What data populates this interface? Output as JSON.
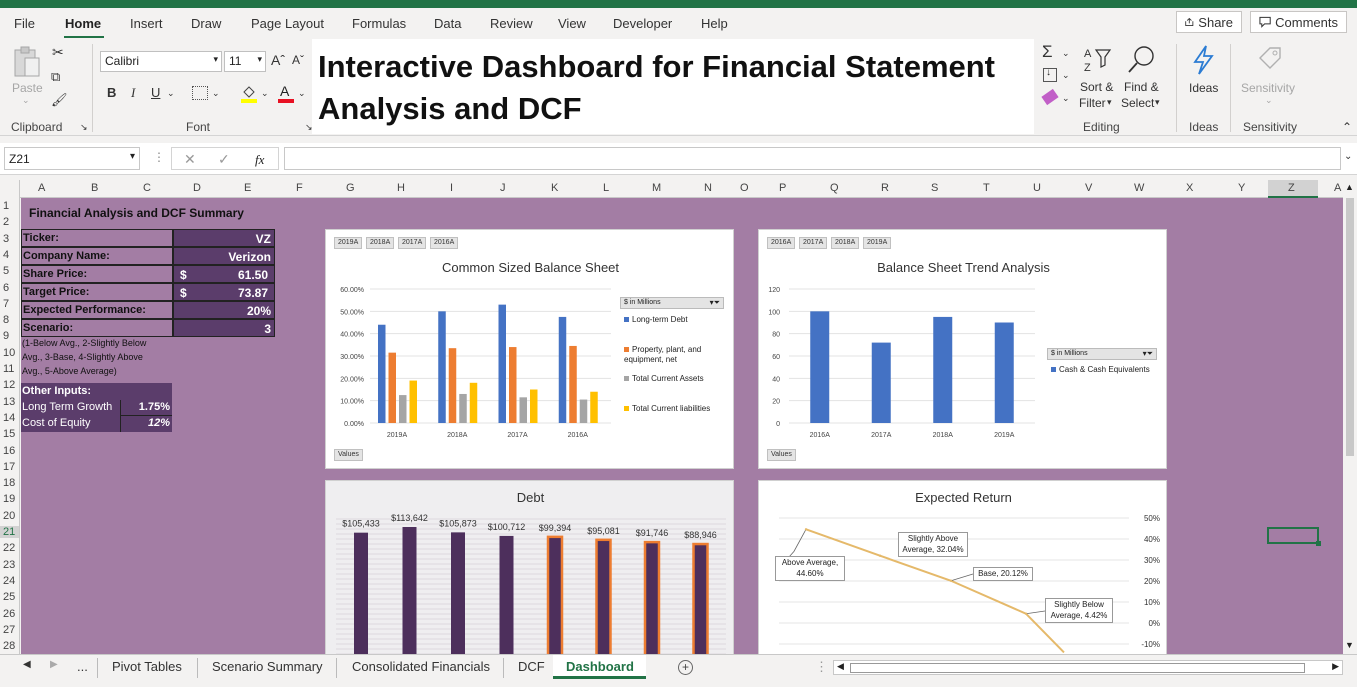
{
  "menu": {
    "tabs": [
      "File",
      "Home",
      "Insert",
      "Draw",
      "Page Layout",
      "Formulas",
      "Data",
      "Review",
      "View",
      "Developer",
      "Help"
    ],
    "active": "Home",
    "share_label": "Share",
    "comments_label": "Comments"
  },
  "ribbon": {
    "paste_label": "Paste",
    "clipboard_label": "Clipboard",
    "font_label": "Font",
    "font_name": "Calibri",
    "font_size": "11",
    "bold": "B",
    "italic": "I",
    "underline": "U",
    "grow_font": "Aˆ",
    "shrink_font": "Aˇ",
    "font_color_letter": "A",
    "editing_label": "Editing",
    "sort_filter_label_1": "Sort &",
    "sort_filter_label_2": "Filter",
    "find_select_label_1": "Find &",
    "find_select_label_2": "Select",
    "ideas_label": "Ideas",
    "ideas_group_label": "Ideas",
    "sensitivity_label": "Sensitivity",
    "sensitivity_group_label": "Sensitivity",
    "colors": {
      "green": "#217346",
      "font_red": "#e81123",
      "fill_yellow": "#ffff00",
      "blue": "#2b7cd3"
    }
  },
  "dashboard_title": {
    "line1": "Interactive Dashboard for Financial Statement",
    "line2": "Analysis and DCF"
  },
  "formula_bar": {
    "name_box": "Z21",
    "formula": ""
  },
  "columns": [
    "A",
    "B",
    "C",
    "D",
    "E",
    "F",
    "G",
    "H",
    "I",
    "J",
    "K",
    "L",
    "M",
    "N",
    "O",
    "P",
    "Q",
    "R",
    "S",
    "T",
    "U",
    "V",
    "W",
    "X",
    "Y",
    "Z",
    "A"
  ],
  "rows": [
    "1",
    "2",
    "3",
    "4",
    "5",
    "6",
    "7",
    "8",
    "9",
    "10",
    "11",
    "12",
    "13",
    "14",
    "15",
    "16",
    "17",
    "18",
    "19",
    "20",
    "21",
    "22",
    "23",
    "24",
    "25",
    "26",
    "27",
    "28"
  ],
  "summary": {
    "heading": "Financial Analysis and DCF Summary",
    "ticker_label": "Ticker:",
    "ticker": "VZ",
    "company_label": "Company Name:",
    "company": "Verizon",
    "share_price_label": "Share Price:",
    "share_price_currency": "$",
    "share_price": "61.50",
    "target_price_label": "Target Price:",
    "target_price_currency": "$",
    "target_price": "73.87",
    "expected_perf_label": "Expected Performance:",
    "expected_perf": "20%",
    "scenario_label": "Scenario:",
    "scenario": "3",
    "scenario_note_1": "(1-Below Avg., 2-Slightly Below",
    "scenario_note_2": "Avg., 3-Base, 4-Slightly Above",
    "scenario_note_3": "Avg., 5-Above Average)",
    "other_inputs_label": "Other Inputs:",
    "ltg_label": "Long Term Growth",
    "ltg": "1.75%",
    "coe_label": "Cost of Equity",
    "coe": "12%",
    "colors": {
      "panel": "#5b3d6b",
      "sheet": "#a37da4"
    }
  },
  "chart_data": [
    {
      "type": "bar",
      "title": "Common Sized Balance Sheet",
      "filter_chips": [
        "2019A",
        "2018A",
        "2017A",
        "2016A"
      ],
      "values_chip": "Values",
      "legend_header": "$ in Millions",
      "categories": [
        "2019A",
        "2018A",
        "2017A",
        "2016A"
      ],
      "ylim": [
        0,
        60
      ],
      "yticks": [
        "0.00%",
        "10.00%",
        "20.00%",
        "30.00%",
        "40.00%",
        "50.00%",
        "60.00%"
      ],
      "series": [
        {
          "name": "Long-term Debt",
          "color": "#4472c4",
          "values": [
            44,
            50,
            53,
            47.5
          ]
        },
        {
          "name": "Property, plant, and equipment, net",
          "color": "#ed7d31",
          "values": [
            31.5,
            33.5,
            34,
            34.5
          ]
        },
        {
          "name": "Total Current Assets",
          "color": "#a5a5a5",
          "values": [
            12.5,
            13,
            11.5,
            10.5
          ]
        },
        {
          "name": "Total Current liabilities",
          "color": "#ffc000",
          "values": [
            19,
            18,
            15,
            14
          ]
        }
      ]
    },
    {
      "type": "bar",
      "title": "Balance Sheet Trend Analysis",
      "filter_chips": [
        "2016A",
        "2017A",
        "2018A",
        "2019A"
      ],
      "values_chip": "Values",
      "legend_header": "$ in Millions",
      "categories": [
        "2016A",
        "2017A",
        "2018A",
        "2019A"
      ],
      "ylim": [
        0,
        120
      ],
      "yticks": [
        "0",
        "20",
        "40",
        "60",
        "80",
        "100",
        "120"
      ],
      "series": [
        {
          "name": "Cash & Cash Equivalents",
          "color": "#4472c4",
          "values": [
            100,
            72,
            95,
            90
          ]
        }
      ]
    },
    {
      "type": "bar",
      "title": "Debt",
      "data_labels": [
        "$105,433",
        "$113,642",
        "$105,873",
        "$100,712",
        "$99,394",
        "$95,081",
        "$91,746",
        "$88,946"
      ],
      "values": [
        105433,
        113642,
        105873,
        100712,
        99394,
        95081,
        91746,
        88946
      ],
      "highlighted": [
        false,
        false,
        false,
        false,
        true,
        true,
        true,
        true
      ],
      "colors": {
        "bar": "#4d2f5c",
        "highlight_border": "#ed7d31"
      }
    },
    {
      "type": "line",
      "title": "Expected Return",
      "ylim": [
        -10,
        50
      ],
      "yticks": [
        "-10%",
        "0%",
        "10%",
        "20%",
        "30%",
        "40%",
        "50%"
      ],
      "points": [
        {
          "label": "Above Average, 44.60%",
          "y": 44.6
        },
        {
          "label": "Slightly Above Average, 32.04%",
          "y": 32.04
        },
        {
          "label": "Base, 20.12%",
          "y": 20.12
        },
        {
          "label": "Slightly Below Average, 4.42%",
          "y": 4.42
        },
        {
          "label": "",
          "y": -14
        }
      ],
      "callouts": {
        "p1_a": "Above Average,",
        "p1_b": "44.60%",
        "p2_a": "Slightly Above",
        "p2_b": "Average, 32.04%",
        "p3": "Base, 20.12%",
        "p4_a": "Slightly Below",
        "p4_b": "Average, 4.42%"
      },
      "color": "#e5b96a"
    }
  ],
  "sheet_tabs": {
    "ellipsis": "...",
    "tabs": [
      "Pivot Tables",
      "Scenario Summary",
      "Consolidated Financials",
      "DCF",
      "Dashboard"
    ],
    "active": "Dashboard",
    "add": "+"
  }
}
